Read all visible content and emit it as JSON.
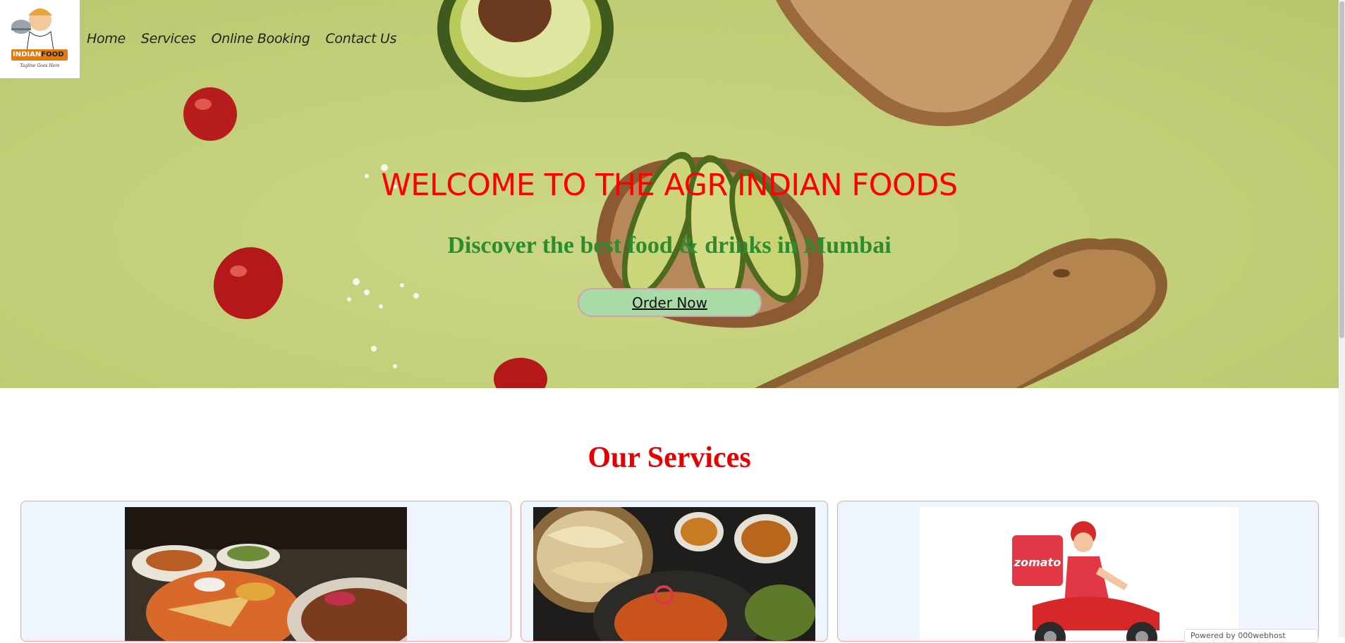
{
  "nav": {
    "home": "Home",
    "services": "Services",
    "online_booking": "Online Booking",
    "contact_us": "Contact Us"
  },
  "logo": {
    "brand_left": "INDIAN",
    "brand_right": "FOOD",
    "tagline": "Tagline Goes Here"
  },
  "hero": {
    "title": "WELCOME TO THE AGR INDIAN FOODS",
    "subtitle": "Discover the best food & drinks in Mumbai",
    "order_button": "Order Now"
  },
  "services": {
    "title": "Our Services",
    "cards": [
      {
        "icon": "restaurant-plates-photo"
      },
      {
        "icon": "indian-dishes-photo"
      },
      {
        "icon": "zomato-delivery-photo",
        "brand": "zomato"
      }
    ]
  },
  "badge": {
    "text": "Powered by 000webhost"
  },
  "colors": {
    "hero_bg": "#c5d27d",
    "title_red": "#ff0000",
    "subtitle_green": "#2e8b2e",
    "button_green": "#a8dba5",
    "card_bg": "#eef5fc",
    "card_border": "#f0a0a0"
  }
}
